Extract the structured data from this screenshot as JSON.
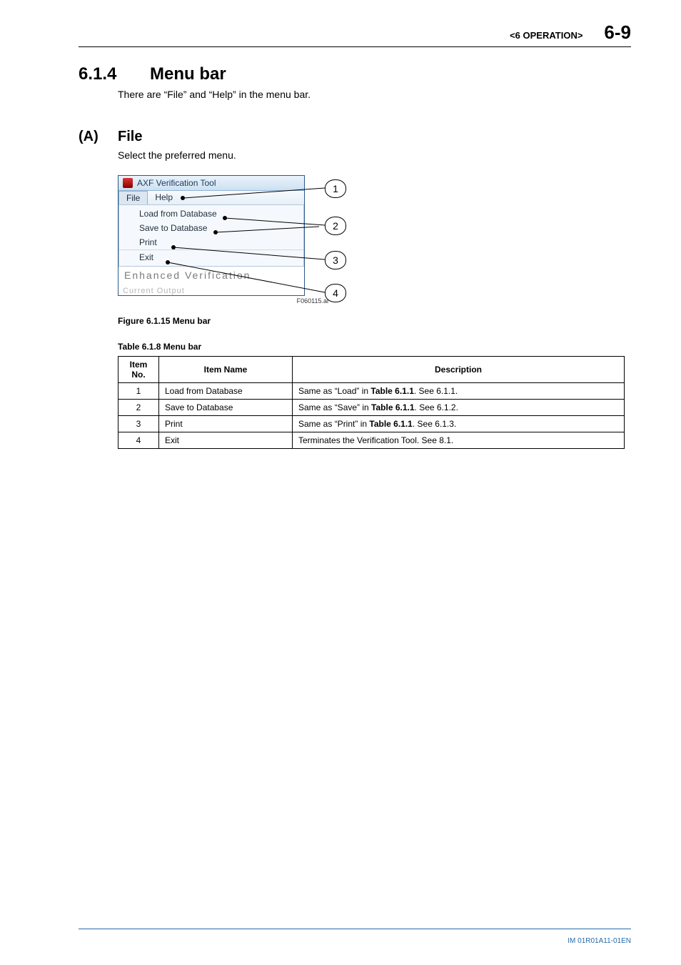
{
  "header": {
    "chapter": "<6  OPERATION>",
    "page_number": "6-9"
  },
  "section": {
    "number": "6.1.4",
    "title": "Menu bar",
    "intro": "There are “File” and “Help” in the menu bar."
  },
  "subsection": {
    "letter": "(A)",
    "title": "File",
    "intro": "Select the preferred menu."
  },
  "screenshot": {
    "window_title": "AXF Verification Tool",
    "menu_file": "File",
    "menu_help": "Help",
    "item_load": "Load from Database",
    "item_save": "Save to Database",
    "item_print": "Print",
    "item_exit": "Exit",
    "fragment_heading": "Enhanced Verification",
    "fragment_sub": "Current Output",
    "callouts": {
      "c1": "1",
      "c2": "2",
      "c3": "3",
      "c4": "4"
    },
    "figure_id": "F060115.ai"
  },
  "figure_caption": "Figure 6.1.15 Menu bar",
  "table_caption": "Table 6.1.8 Menu bar",
  "table": {
    "head": {
      "no": "Item No.",
      "name": "Item Name",
      "desc": "Description"
    },
    "rows": [
      {
        "no": "1",
        "name": "Load from Database",
        "desc_pre": "Same as “Load” in ",
        "desc_bold": "Table 6.1.1",
        "desc_post": ". See 6.1.1."
      },
      {
        "no": "2",
        "name": "Save to Database",
        "desc_pre": "Same as “Save” in ",
        "desc_bold": "Table 6.1.1",
        "desc_post": ". See 6.1.2."
      },
      {
        "no": "3",
        "name": "Print",
        "desc_pre": "Same as “Print” in ",
        "desc_bold": "Table 6.1.1",
        "desc_post": ". See 6.1.3."
      },
      {
        "no": "4",
        "name": "Exit",
        "desc_pre": "Terminates the Verification Tool. See 8.1.",
        "desc_bold": "",
        "desc_post": ""
      }
    ]
  },
  "footer": {
    "doc_id": "IM 01R01A11-01EN"
  }
}
